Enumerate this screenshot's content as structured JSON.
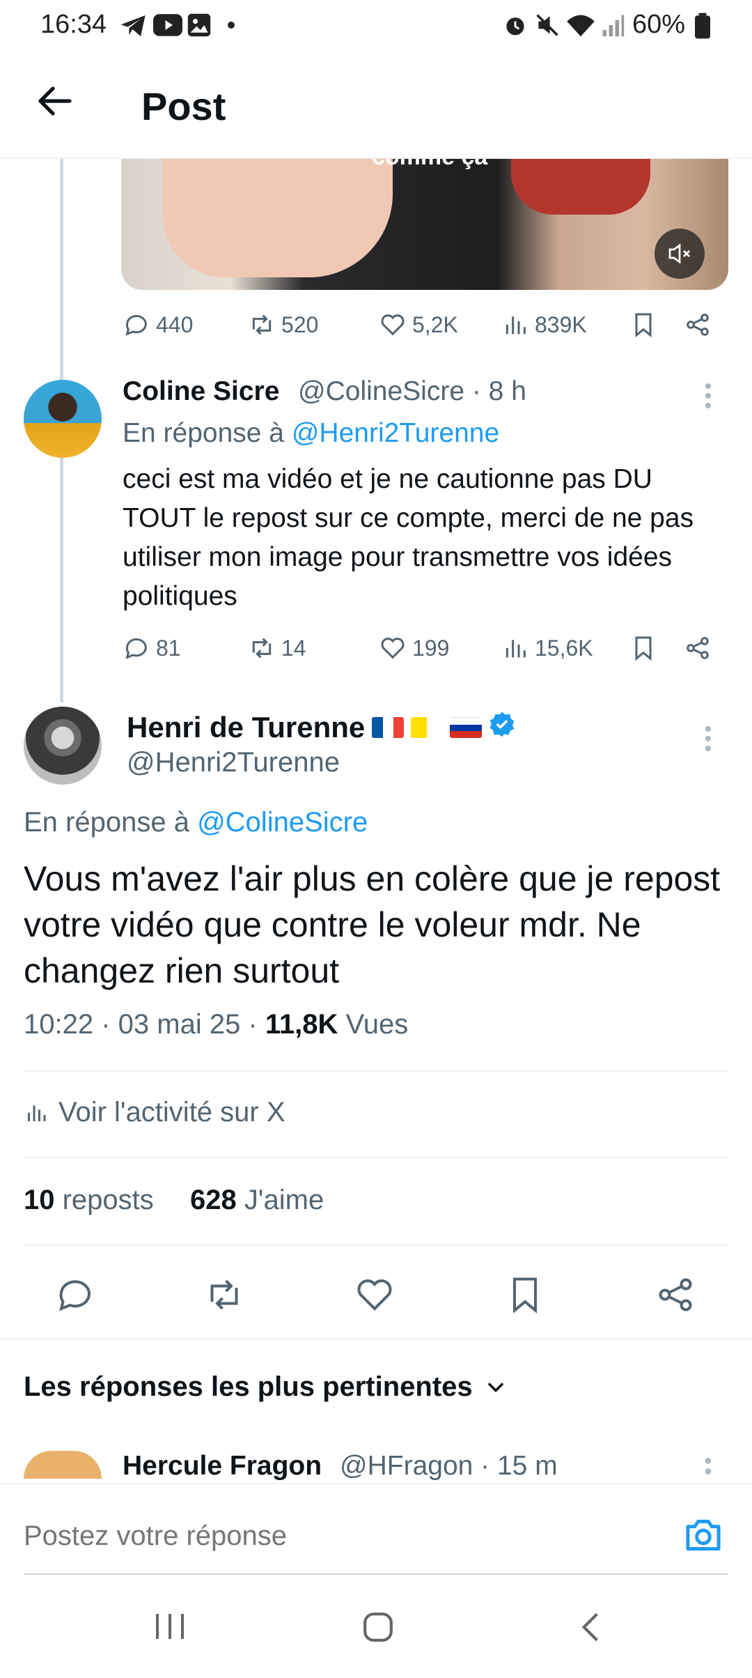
{
  "status_bar": {
    "time": "16:34",
    "battery_pct": "60%",
    "left_icons": [
      "telegram-icon",
      "youtube-icon",
      "gallery-icon",
      "dot-icon"
    ],
    "right_icons": [
      "alarm-icon",
      "mute-icon",
      "wifi-icon",
      "signal-icon",
      "battery-icon"
    ]
  },
  "header": {
    "title": "Post"
  },
  "video": {
    "caption": "comme ça"
  },
  "first_actions": {
    "replies": "440",
    "reposts": "520",
    "likes": "5,2K",
    "views": "839K"
  },
  "coline": {
    "name": "Coline Sicre",
    "handle": "@ColineSicre · 8 h",
    "reply_prefix": "En réponse à ",
    "reply_to": "@Henri2Turenne",
    "text": "ceci est ma vidéo et je ne cautionne pas DU TOUT le repost sur ce compte, merci de ne pas utiliser mon image pour transmettre vos idées politiques",
    "replies": "81",
    "reposts": "14",
    "likes": "199",
    "views": "15,6K"
  },
  "henri": {
    "name": "Henri de Turenne",
    "handle": "@Henri2Turenne",
    "reply_prefix": "En réponse à ",
    "reply_to": "@ColineSicre",
    "text": "Vous m'avez l'air plus en colère que je repost votre vidéo que contre le voleur mdr. Ne changez rien surtout",
    "time_date": "10:22 · 03 mai 25 · ",
    "views_count": "11,8K",
    "views_label": " Vues",
    "activity_label": "Voir l'activité sur X",
    "reposts_count": "10",
    "reposts_label": " reposts",
    "likes_count": "628",
    "likes_label": " J'aime"
  },
  "relevant_label": "Les réponses les plus pertinentes",
  "hercule": {
    "name": "Hercule Fragon",
    "handle": "@HFragon · 15 m"
  },
  "composer": {
    "placeholder": "Postez votre réponse"
  },
  "colors": {
    "accent": "#1d9bf0",
    "muted": "#536471",
    "divider": "#eff3f4"
  }
}
